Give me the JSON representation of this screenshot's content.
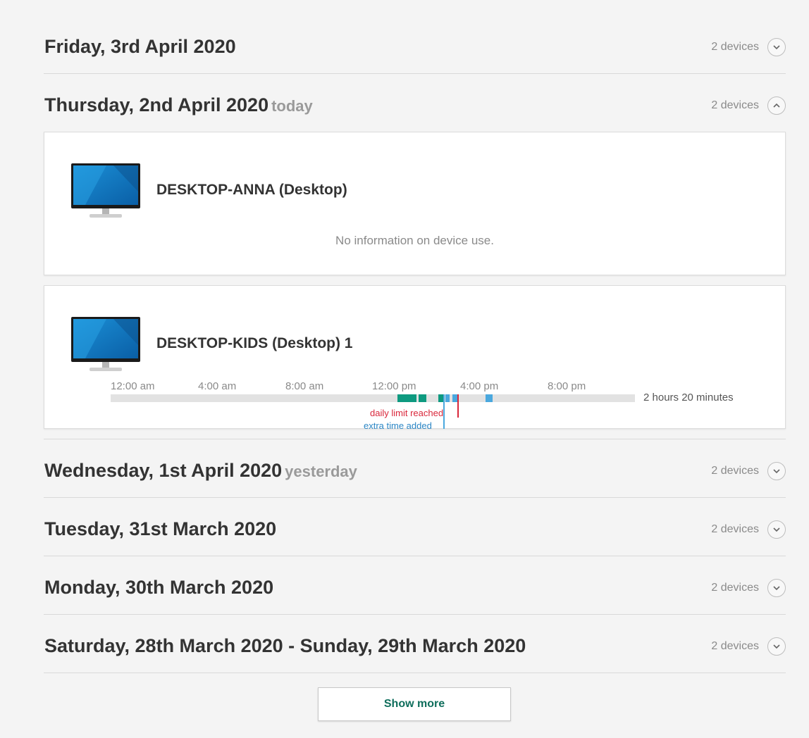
{
  "days": [
    {
      "date": "Friday, 3rd April 2020",
      "relative": "",
      "devices": "2 devices",
      "expanded": false
    },
    {
      "date": "Thursday, 2nd April 2020",
      "relative": "today",
      "devices": "2 devices",
      "expanded": true
    },
    {
      "date": "Wednesday, 1st April 2020",
      "relative": "yesterday",
      "devices": "2 devices",
      "expanded": false
    },
    {
      "date": "Tuesday, 31st March 2020",
      "relative": "",
      "devices": "2 devices",
      "expanded": false
    },
    {
      "date": "Monday, 30th March 2020",
      "relative": "",
      "devices": "2 devices",
      "expanded": false
    },
    {
      "date": "Saturday, 28th March 2020 - Sunday, 29th March 2020",
      "relative": "",
      "devices": "2 devices",
      "expanded": false
    }
  ],
  "device_anna": {
    "name": "DESKTOP-ANNA (Desktop)",
    "no_info": "No information on device use."
  },
  "device_kids": {
    "name": "DESKTOP-KIDS (Desktop) 1",
    "total": "2 hours 20 minutes",
    "ticks": [
      "12:00 am",
      "4:00 am",
      "8:00 am",
      "12:00 pm",
      "4:00 pm",
      "8:00 pm"
    ],
    "daily_limit_label": "daily limit reached",
    "extra_time_label": "extra time added",
    "colors": {
      "usage": "#0e9a80",
      "extra": "#4aa8de",
      "limit": "#d9263a",
      "track": "#e2e2e2"
    }
  },
  "show_more": "Show more",
  "icons": {
    "expand": "chevron-down-icon",
    "collapse": "chevron-up-icon",
    "device": "monitor-icon"
  }
}
